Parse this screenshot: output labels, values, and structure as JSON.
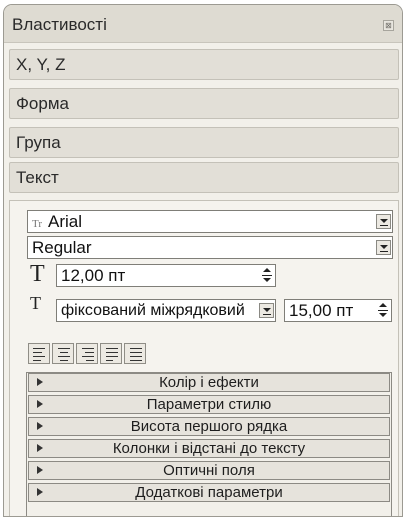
{
  "panel": {
    "title": "Властивості",
    "close_glyph": "⊠"
  },
  "sections": [
    "X, Y, Z",
    "Форма",
    "Група",
    "Текст"
  ],
  "text_section": {
    "font_family": "Arial",
    "font_style": "Regular",
    "font_size": "12,00 пт",
    "leading_mode": "фіксований міжрядковий",
    "leading_value": "15,00 пт",
    "alignment_buttons": [
      "align-left",
      "align-center",
      "align-right",
      "justify",
      "force-justify"
    ]
  },
  "expandable_items": [
    "Колір і ефекти",
    "Параметри стилю",
    "Висота першого рядка",
    "Колонки і відстані до тексту",
    "Оптичні поля",
    "Додаткові параметри"
  ],
  "icons": {
    "font_icon": "Tr",
    "size_icon": "T",
    "leading_icon": "T"
  }
}
